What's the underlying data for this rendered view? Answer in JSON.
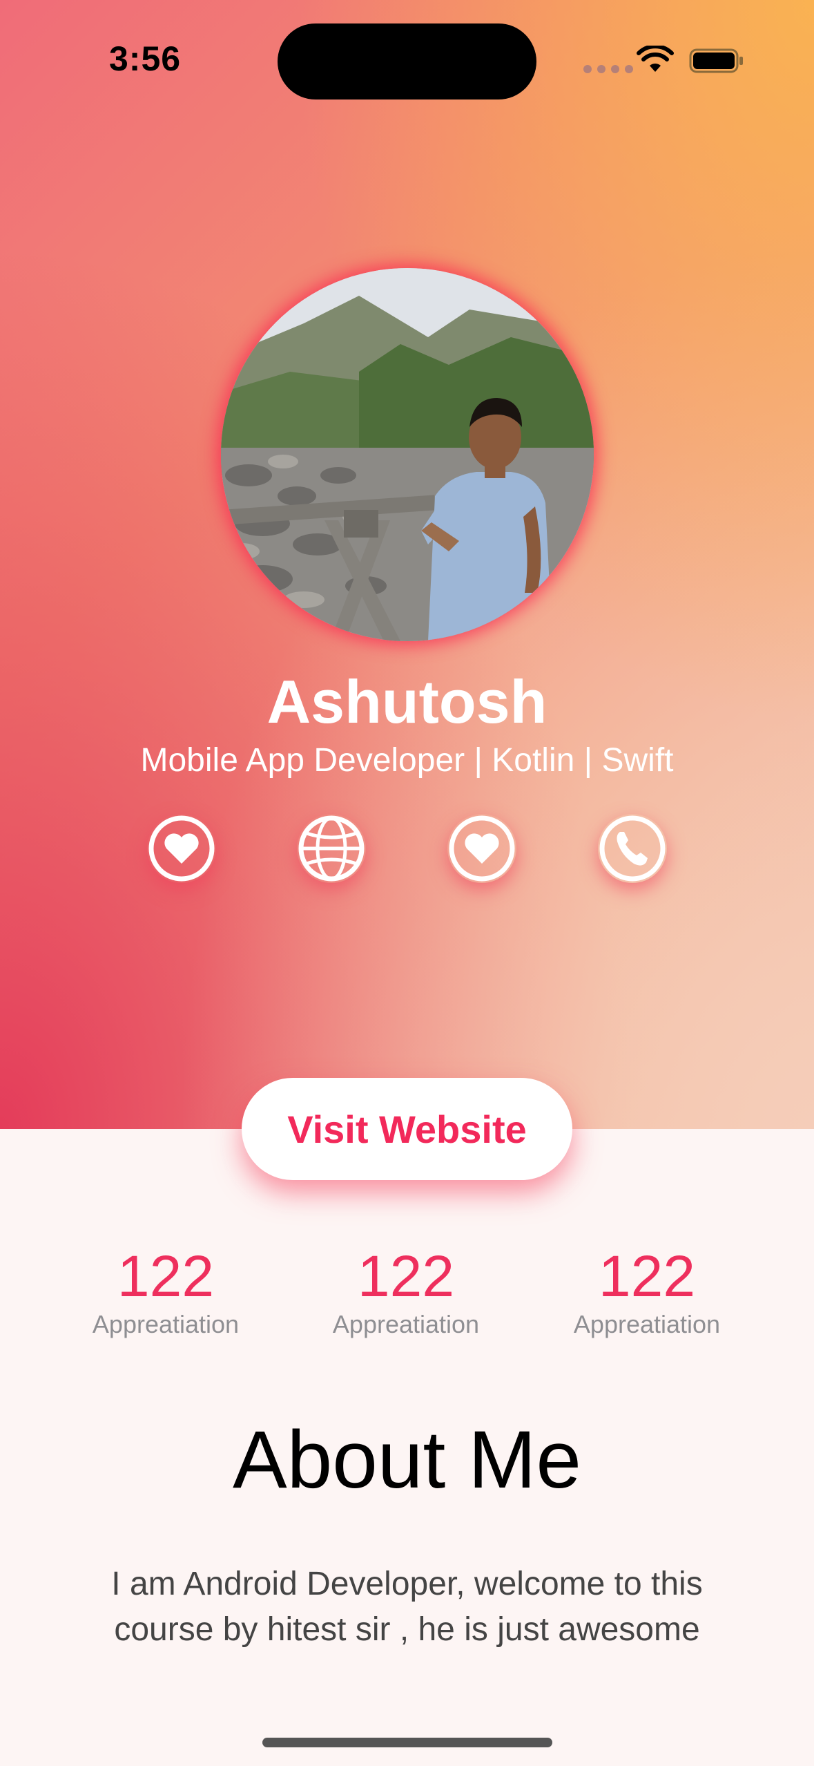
{
  "status_bar": {
    "time": "3:56"
  },
  "profile": {
    "name": "Ashutosh",
    "subtitle": "Mobile App Developer | Kotlin | Swift",
    "avatar_alt": "profile photo"
  },
  "social_buttons": [
    {
      "icon": "heart-icon"
    },
    {
      "icon": "globe-icon"
    },
    {
      "icon": "heart-icon"
    },
    {
      "icon": "phone-icon"
    }
  ],
  "visit_button": {
    "label": "Visit Website"
  },
  "stats": [
    {
      "value": "122",
      "label": "Appreatiation"
    },
    {
      "value": "122",
      "label": "Appreatiation"
    },
    {
      "value": "122",
      "label": "Appreatiation"
    }
  ],
  "about": {
    "title": "About Me",
    "text": "I am Android Developer, welcome to this course by hitest sir , he is just awesome"
  },
  "colors": {
    "accent": "#f2295a",
    "stat_value": "#ee2f5d",
    "stat_label": "#8e8e92",
    "background": "#fdf5f4"
  }
}
